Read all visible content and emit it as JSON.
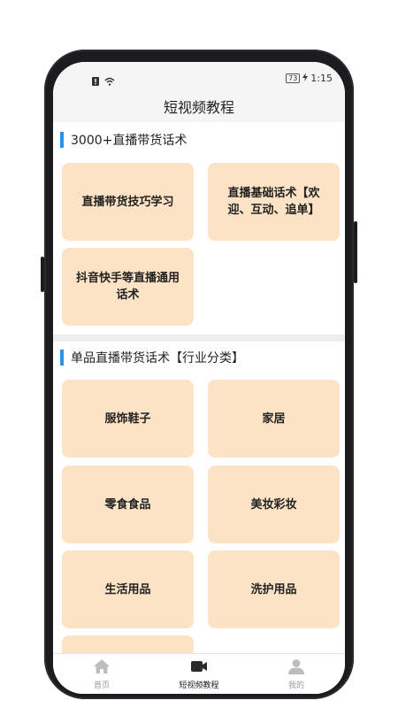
{
  "status": {
    "battery": "73",
    "time": "1:15",
    "icons": [
      "alert-icon",
      "wifi-icon",
      "battery-icon",
      "charging-icon"
    ]
  },
  "header": {
    "title": "短视频教程"
  },
  "sections": [
    {
      "title": "3000+直播带货话术",
      "cards": [
        "直播带货技巧学习",
        "直播基础话术【欢迎、互动、追单】",
        "抖音快手等直播通用话术"
      ]
    },
    {
      "title": "单品直播带货话术【行业分类】",
      "cards": [
        "服饰鞋子",
        "家居",
        "零食食品",
        "美妆彩妆",
        "生活用品",
        "洗护用品",
        ""
      ]
    }
  ],
  "tabs": [
    {
      "label": "首页",
      "icon": "home-icon"
    },
    {
      "label": "短视频教程",
      "icon": "video-camera-icon"
    },
    {
      "label": "我的",
      "icon": "user-icon"
    }
  ],
  "colors": {
    "card": "#fde3c5",
    "accent_bar": "#2e8fe6",
    "tab_active": "#222222",
    "tab_inactive": "#999999"
  }
}
